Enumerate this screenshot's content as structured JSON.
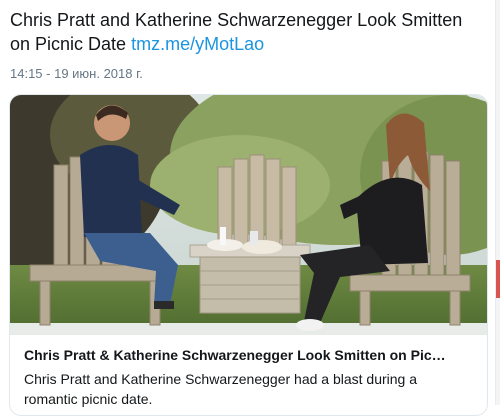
{
  "tweet": {
    "text": "Chris Pratt and Katherine Schwarzenegger Look Smitten on Picnic Date",
    "link": "tmz.me/yMotLao",
    "timestamp": "14:15 - 19 июн. 2018 г."
  },
  "card": {
    "image": "photo of a couple seated on two wooden Adirondack chairs at a picnic table",
    "title": "Chris Pratt & Katherine Schwarzenegger Look Smitten on Pic…",
    "description": "Chris Pratt and Katherine Schwarzenegger had a blast during a romantic picnic date."
  },
  "colors": {
    "link": "#1b95e0",
    "text": "#14171a",
    "muted": "#657786",
    "border": "#e1e8ed"
  }
}
